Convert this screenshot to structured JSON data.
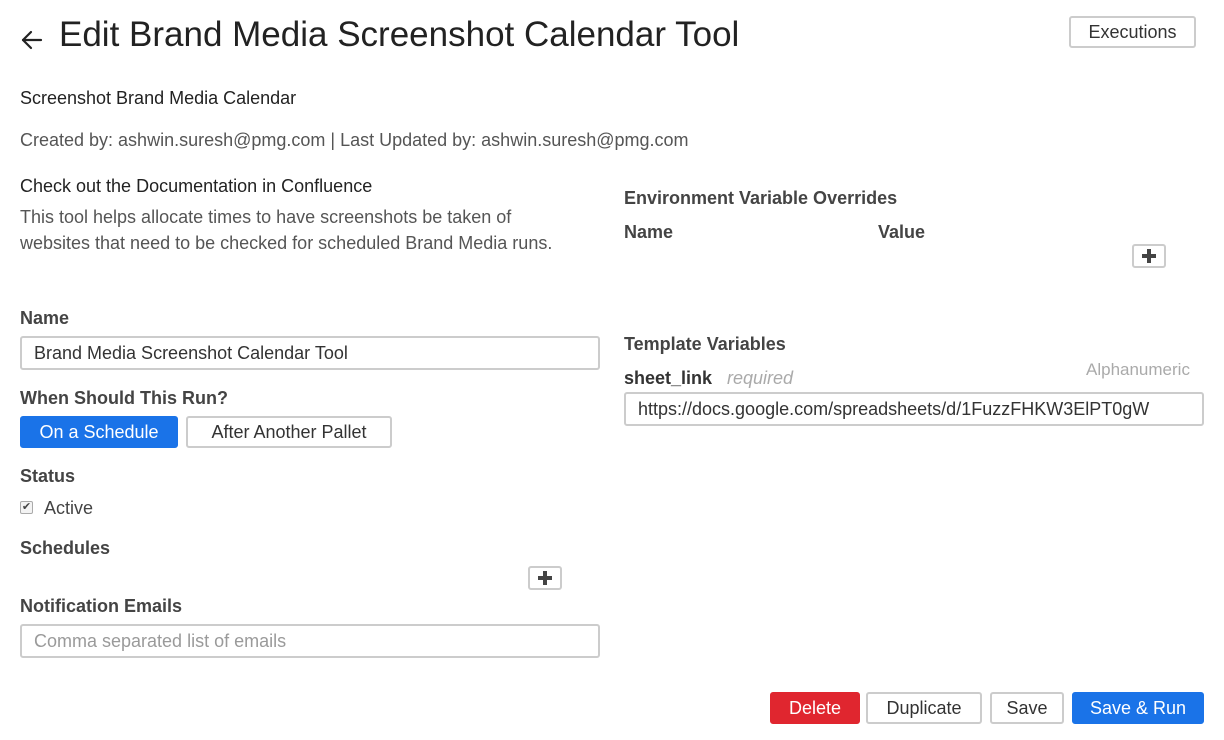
{
  "header": {
    "title": "Edit Brand Media Screenshot Calendar Tool",
    "executions_label": "Executions"
  },
  "summary": {
    "subtitle": "Screenshot Brand Media Calendar",
    "meta": "Created by: ashwin.suresh@pmg.com | Last Updated by: ashwin.suresh@pmg.com",
    "doc_link": "Check out the Documentation in Confluence",
    "description": "This tool helps allocate times to have screenshots be taken of websites that need to be checked for scheduled Brand Media runs."
  },
  "form": {
    "name_label": "Name",
    "name_value": "Brand Media Screenshot Calendar Tool",
    "run_label": "When Should This Run?",
    "run_options": [
      "On a Schedule",
      "After Another Pallet"
    ],
    "run_selected": "On a Schedule",
    "status_label": "Status",
    "active_label": "Active",
    "active_checked": true,
    "schedules_label": "Schedules",
    "notif_label": "Notification Emails",
    "notif_placeholder": "Comma separated list of emails"
  },
  "env": {
    "title": "Environment Variable Overrides",
    "name_col": "Name",
    "value_col": "Value"
  },
  "template": {
    "title": "Template Variables",
    "var_name": "sheet_link",
    "var_required": "required",
    "var_type": "Alphanumeric",
    "var_value": "https://docs.google.com/spreadsheets/d/1FuzzFHKW3ElPT0gW"
  },
  "footer": {
    "delete_label": "Delete",
    "duplicate_label": "Duplicate",
    "save_label": "Save",
    "save_run_label": "Save & Run"
  },
  "colors": {
    "primary": "#1a73e8",
    "danger": "#e0262f"
  },
  "icons": [
    "back-arrow-icon",
    "plus-icon",
    "checkmark-icon"
  ]
}
